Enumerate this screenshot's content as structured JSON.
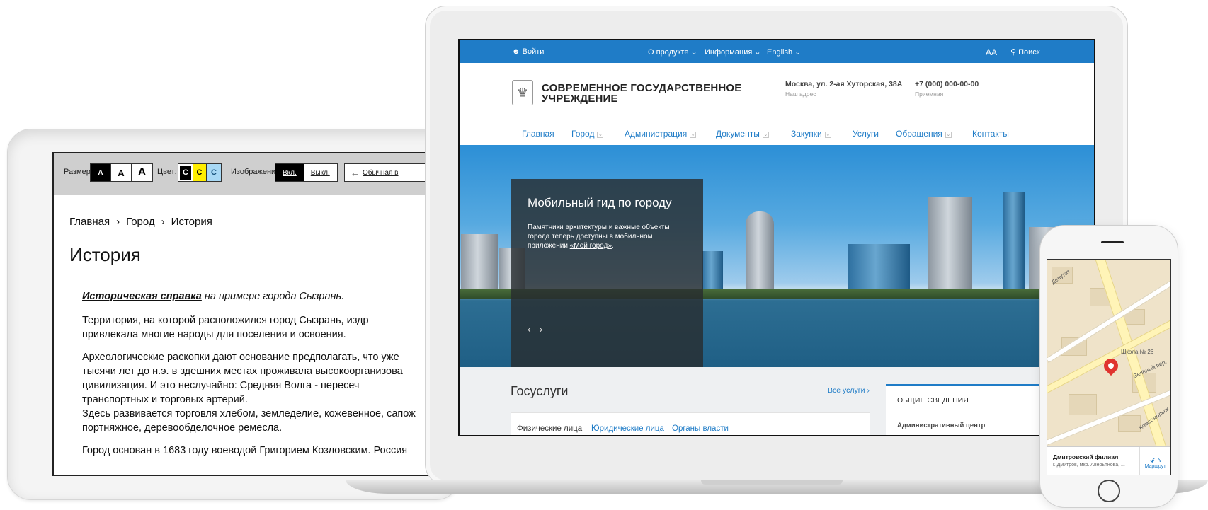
{
  "tablet": {
    "accessibility_bar": {
      "size_label": "Размер:",
      "size_options": [
        "A",
        "A",
        "A"
      ],
      "color_label": "Цвет:",
      "color_options": [
        "C",
        "C",
        "C"
      ],
      "images_label": "Изображения",
      "images_on": "Вкл.",
      "images_off": "Выкл.",
      "normal_version_arrow": "←",
      "normal_version_label": "Обычная в"
    },
    "breadcrumbs": {
      "home": "Главная",
      "sep1": "›",
      "city": "Город",
      "sep2": "›",
      "current": "История"
    },
    "title": "История",
    "article": {
      "lead_link": "Историческая справка",
      "lead_rest": " на примере города Сызрань.",
      "paragraphs": [
        "Территория, на которой расположился город Сызрань, издр",
        "привлекала многие народы для поселения и освоения.",
        "Археологические раскопки дают основание предполагать, что уже",
        "тысячи лет до н.э. в здешних местах проживала высокоорганизова",
        "цивилизация. И это неслучайно: Средняя Волга - пересеч",
        "транспортных и торговых артерий.",
        "Здесь развивается торговля хлебом, земледелие, кожевенное, сапож",
        "портняжное, деревообделочное ремесла.",
        "Город основан в 1683 году воеводой Григорием Козловским. Россия"
      ]
    }
  },
  "laptop": {
    "topbar": {
      "login": "Войти",
      "about": "О продукте",
      "info": "Информация",
      "lang": "English",
      "font_size": "AA",
      "search": "Поиск"
    },
    "header": {
      "org_line1": "СОВРЕМЕННОЕ ГОСУДАРСТВЕННОЕ",
      "org_line2": "УЧРЕЖДЕНИЕ",
      "address": "Москва, ул. 2-ая Хуторская, 38А",
      "address_caption": "Наш адрес",
      "phone": "+7 (000) 000-00-00",
      "phone_caption": "Приемная"
    },
    "nav": [
      "Главная",
      "Город",
      "Администрация",
      "Документы",
      "Закупки",
      "Услуги",
      "Обращения",
      "Контакты"
    ],
    "slider": {
      "title": "Мобильный гид по городу",
      "text": "Памятники архитектуры и важные объекты города теперь доступны в мобильном приложении ",
      "app_link": "«Мой город»",
      "text_end": ".",
      "prev": "‹",
      "next": "›"
    },
    "services": {
      "title": "Госуслуги",
      "all_link": "Все услуги ›",
      "tabs": [
        "Физические лица",
        "Юридические лица",
        "Органы власти"
      ]
    },
    "info_card": {
      "title": "ОБЩИЕ СВЕДЕНИЯ",
      "subtitle": "Административный центр"
    }
  },
  "phone": {
    "map_labels": [
      "Депутат",
      "Школа № 26",
      "Зелёный пер.",
      "Комсомольск"
    ],
    "branch_name": "Дмитровский филиал",
    "branch_address": "г. Дмитров, мкр. Аверьянова, ...",
    "route_label": "Маршрут"
  },
  "colors": {
    "accent": "#1f7cc7",
    "a11y_bar": "#cfcfcf",
    "pin": "#e0342f"
  }
}
